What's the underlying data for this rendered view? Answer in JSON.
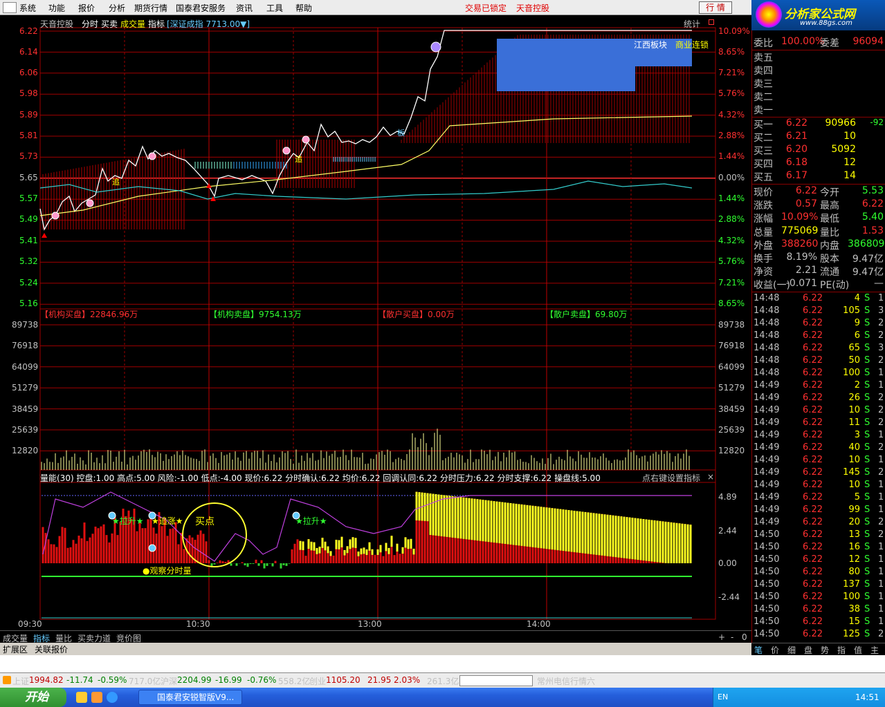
{
  "menu": {
    "items": [
      "系统",
      "功能",
      "报价",
      "分析",
      "期货行情",
      "国泰君安服务",
      "资讯",
      "工具",
      "帮助"
    ],
    "status_left": "交易已锁定",
    "status_right": "天音控股",
    "quote_button": "行 情"
  },
  "logo": {
    "brand": "分析家公式网",
    "url": "www.88gs.com"
  },
  "chart_header": {
    "stock": "天音控股",
    "tabs": [
      "分时",
      "买卖",
      "成交量",
      "指标"
    ],
    "index_text": "[深证成指 7713.00▼]",
    "stats_button": "统计"
  },
  "price_axis": {
    "left_labels": [
      "6.22",
      "6.14",
      "6.06",
      "5.98",
      "5.89",
      "5.81",
      "5.73",
      "5.65",
      "5.57",
      "5.49",
      "5.41",
      "5.32",
      "5.24",
      "5.16"
    ],
    "right_labels": [
      "10.09%",
      "8.65%",
      "7.21%",
      "5.76%",
      "4.32%",
      "2.88%",
      "1.44%",
      "0.00%",
      "1.44%",
      "2.88%",
      "4.32%",
      "5.76%",
      "7.21%",
      "8.65%"
    ]
  },
  "block_labels": {
    "sector": "江西板块",
    "concept": "商业连锁"
  },
  "flow_labels": [
    {
      "name": "【机构买盘】",
      "value": "22846.96万",
      "color": "#ff3030"
    },
    {
      "name": "【机构卖盘】",
      "value": "9754.13万",
      "color": "#30ff30"
    },
    {
      "name": "【散户买盘】",
      "value": "0.00万",
      "color": "#ff3030"
    },
    {
      "name": "【散户卖盘】",
      "value": "69.80万",
      "color": "#30ff30"
    }
  ],
  "volume_axis": {
    "labels": [
      "89738",
      "76918",
      "64099",
      "51279",
      "38459",
      "25639",
      "12820"
    ]
  },
  "indicator_header": {
    "items": [
      "量能(30)",
      "控盘:1.00",
      "高点:5.00",
      "风险:-1.00",
      "低点:-4.00",
      "现价:6.22",
      "分时确认:6.22",
      "均价:6.22",
      "回调认同:6.22",
      "分时压力:6.22",
      "分时支撑:6.22",
      "操盘线:5.00"
    ],
    "settings_hint": "点右键设置指标"
  },
  "indicator_axis": {
    "labels": [
      "4.89",
      "2.44",
      "0.00",
      "-2.44"
    ]
  },
  "indicator_annotations": {
    "pull_up_1": "★拉升★",
    "chase": "★追涨★",
    "buy_point": "买点",
    "watch": "●观察分时量",
    "pull_up_2": "★拉升★"
  },
  "price_markers": {
    "limit": "板",
    "up": "追",
    "start": "追"
  },
  "time_axis": {
    "labels": [
      "09:30",
      "10:30",
      "13:00",
      "14:00"
    ]
  },
  "bottom_tabs": [
    "成交量",
    "指标",
    "量比",
    "买卖力道",
    "竞价图"
  ],
  "bottom_controls": [
    "+",
    "-",
    "0"
  ],
  "ext_tabs": [
    "扩展区",
    "关联报价"
  ],
  "sidebar": {
    "ratio": {
      "label1": "委比",
      "value1": "100.00%",
      "label2": "委差",
      "value2": "96094"
    },
    "sell_levels": [
      "卖五",
      "卖四",
      "卖三",
      "卖二",
      "卖一"
    ],
    "buy_levels": [
      {
        "label": "买一",
        "price": "6.22",
        "vol": "90966",
        "chg": "-92"
      },
      {
        "label": "买二",
        "price": "6.21",
        "vol": "10",
        "chg": ""
      },
      {
        "label": "买三",
        "price": "6.20",
        "vol": "5092",
        "chg": ""
      },
      {
        "label": "买四",
        "price": "6.18",
        "vol": "12",
        "chg": ""
      },
      {
        "label": "买五",
        "price": "6.17",
        "vol": "14",
        "chg": ""
      }
    ],
    "stats": [
      {
        "k1": "现价",
        "v1": "6.22",
        "c1": "#ff3030",
        "k2": "今开",
        "v2": "5.53",
        "c2": "#30ff30"
      },
      {
        "k1": "涨跌",
        "v1": "0.57",
        "c1": "#ff3030",
        "k2": "最高",
        "v2": "6.22",
        "c2": "#ff3030"
      },
      {
        "k1": "涨幅",
        "v1": "10.09%",
        "c1": "#ff3030",
        "k2": "最低",
        "v2": "5.40",
        "c2": "#30ff30"
      },
      {
        "k1": "总量",
        "v1": "775069",
        "c1": "#ffff00",
        "k2": "量比",
        "v2": "1.53",
        "c2": "#ff3030"
      },
      {
        "k1": "外盘",
        "v1": "388260",
        "c1": "#ff3030",
        "k2": "内盘",
        "v2": "386809",
        "c2": "#30ff30"
      },
      {
        "k1": "换手",
        "v1": "8.19%",
        "c1": "#c0c0c0",
        "k2": "股本",
        "v2": "9.47亿",
        "c2": "#c0c0c0"
      },
      {
        "k1": "净资",
        "v1": "2.21",
        "c1": "#c0c0c0",
        "k2": "流通",
        "v2": "9.47亿",
        "c2": "#c0c0c0"
      },
      {
        "k1": "收益(一)",
        "v1": "-0.071",
        "c1": "#c0c0c0",
        "k2": "PE(动)",
        "v2": "—",
        "c2": "#c0c0c0"
      }
    ],
    "ticks": [
      [
        "14:48",
        "6.22",
        "4",
        "S",
        "1"
      ],
      [
        "14:48",
        "6.22",
        "105",
        "S",
        "3"
      ],
      [
        "14:48",
        "6.22",
        "9",
        "S",
        "2"
      ],
      [
        "14:48",
        "6.22",
        "6",
        "S",
        "2"
      ],
      [
        "14:48",
        "6.22",
        "65",
        "S",
        "3"
      ],
      [
        "14:48",
        "6.22",
        "50",
        "S",
        "2"
      ],
      [
        "14:48",
        "6.22",
        "100",
        "S",
        "1"
      ],
      [
        "14:49",
        "6.22",
        "2",
        "S",
        "1"
      ],
      [
        "14:49",
        "6.22",
        "26",
        "S",
        "2"
      ],
      [
        "14:49",
        "6.22",
        "10",
        "S",
        "2"
      ],
      [
        "14:49",
        "6.22",
        "11",
        "S",
        "2"
      ],
      [
        "14:49",
        "6.22",
        "3",
        "S",
        "1"
      ],
      [
        "14:49",
        "6.22",
        "40",
        "S",
        "2"
      ],
      [
        "14:49",
        "6.22",
        "10",
        "S",
        "1"
      ],
      [
        "14:49",
        "6.22",
        "145",
        "S",
        "2"
      ],
      [
        "14:49",
        "6.22",
        "10",
        "S",
        "1"
      ],
      [
        "14:49",
        "6.22",
        "5",
        "S",
        "1"
      ],
      [
        "14:49",
        "6.22",
        "99",
        "S",
        "1"
      ],
      [
        "14:49",
        "6.22",
        "20",
        "S",
        "2"
      ],
      [
        "14:50",
        "6.22",
        "13",
        "S",
        "2"
      ],
      [
        "14:50",
        "6.22",
        "16",
        "S",
        "1"
      ],
      [
        "14:50",
        "6.22",
        "12",
        "S",
        "1"
      ],
      [
        "14:50",
        "6.22",
        "80",
        "S",
        "1"
      ],
      [
        "14:50",
        "6.22",
        "137",
        "S",
        "1"
      ],
      [
        "14:50",
        "6.22",
        "100",
        "S",
        "1"
      ],
      [
        "14:50",
        "6.22",
        "38",
        "S",
        "1"
      ],
      [
        "14:50",
        "6.22",
        "15",
        "S",
        "1"
      ],
      [
        "14:50",
        "6.22",
        "125",
        "S",
        "2"
      ]
    ],
    "tabs": [
      "笔",
      "价",
      "细",
      "盘",
      "势",
      "指",
      "值",
      "主"
    ]
  },
  "index_bar": [
    {
      "text": "上证",
      "color": "#000"
    },
    {
      "text": "1994.82",
      "color": "#c00000"
    },
    {
      "text": "-11.74",
      "color": "#008000"
    },
    {
      "text": "-0.59%",
      "color": "#008000"
    },
    {
      "text": "717.0亿",
      "color": "#000"
    },
    {
      "text": "沪深",
      "color": "#000"
    },
    {
      "text": "2204.99",
      "color": "#008000"
    },
    {
      "text": "-16.99",
      "color": "#008000"
    },
    {
      "text": "-0.76%",
      "color": "#008000"
    },
    {
      "text": "558.2亿",
      "color": "#000"
    },
    {
      "text": "创业",
      "color": "#000"
    },
    {
      "text": "1105.20",
      "color": "#c00000"
    },
    {
      "text": "21.95",
      "color": "#c00000"
    },
    {
      "text": "2.03%",
      "color": "#c00000"
    },
    {
      "text": "261.3亿",
      "color": "#000"
    },
    {
      "text": "常州电信行情六",
      "color": "#000"
    }
  ],
  "taskbar": {
    "start": "开始",
    "window": "国泰君安锐智版V9...",
    "lang": "EN",
    "clock": "14:51"
  }
}
